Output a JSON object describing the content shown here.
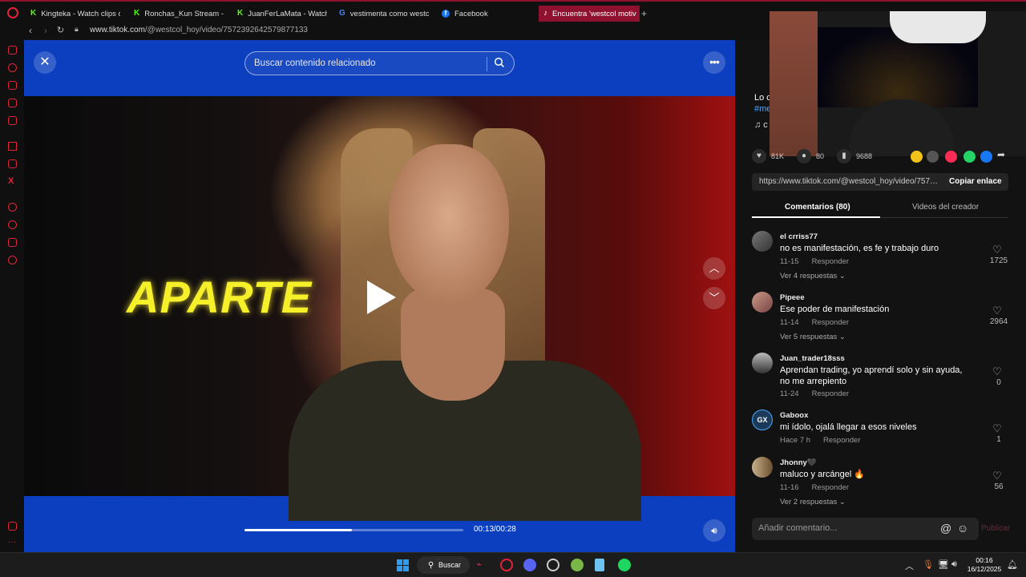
{
  "browser": {
    "tabs": [
      {
        "label": "Kingteka - Watch clips on",
        "favicon": "kick-icon"
      },
      {
        "label": "Ronchas_Kun Stream - W",
        "favicon": "kick-icon"
      },
      {
        "label": "JuanFerLaMata - Watch",
        "favicon": "kick-icon"
      },
      {
        "label": "vestimenta como westco",
        "favicon": "google-icon"
      },
      {
        "label": "Facebook",
        "favicon": "facebook-icon"
      },
      {
        "label": "Encuentra 'westcol motiv",
        "favicon": "tiktok-icon"
      }
    ],
    "new_tab": "+",
    "url_domain": "www.tiktok.com",
    "url_path": "/@westcol_hoy/video/7572392642579877133"
  },
  "video": {
    "search_placeholder": "Buscar contenido relacionado",
    "overlay_text": "APARTE",
    "current_time": "00:13",
    "duration": "00:28",
    "time_display": "00:13/00:28",
    "progress": 0.49,
    "close_symbol": "✕",
    "more_symbol": "•••"
  },
  "panel": {
    "author_partial": "Lo c",
    "tag_partial": "#me",
    "music_partial": "♫ c",
    "stats": [
      {
        "icon": "heart-icon",
        "value": "81K"
      },
      {
        "icon": "comment-icon",
        "value": "80"
      },
      {
        "icon": "bookmark-icon",
        "value": "9688"
      }
    ],
    "share_link": "https://www.tiktok.com/@westcol_hoy/video/7572...",
    "copy_label": "Copiar enlace",
    "tab_comments": "Comentarios (80)",
    "tab_creator": "Videos del creador",
    "comments": [
      {
        "user": "el crriss77",
        "text": "no es manifestación, es fe y trabajo duro",
        "date": "11-15",
        "reply": "Responder",
        "replies": "Ver 4 respuestas ⌄",
        "likes": "1725"
      },
      {
        "user": "Pipeee",
        "text": "Ese poder de manifestación",
        "date": "11-14",
        "reply": "Responder",
        "replies": "Ver 5 respuestas ⌄",
        "likes": "2964"
      },
      {
        "user": "Juan_trader18sss",
        "text": "Aprendan trading, yo aprendí solo y sin ayuda, no me arrepiento",
        "date": "11-24",
        "reply": "Responder",
        "replies": "",
        "likes": "0"
      },
      {
        "user": "Gaboox",
        "text": "mi ídolo, ojalá llegar a esos niveles",
        "date": "Hace 7 h",
        "reply": "Responder",
        "replies": "",
        "likes": "1"
      },
      {
        "user": "Jhonny🖤",
        "text": "maluco y arcángel 🔥",
        "date": "11-16",
        "reply": "Responder",
        "replies": "Ver 2 respuestas ⌄",
        "likes": "56"
      }
    ],
    "comment_placeholder": "Añadir comentario...",
    "publish_label": "Publicar"
  },
  "taskbar": {
    "search_label": "Buscar",
    "time": "00:16",
    "date": "16/12/2025"
  }
}
